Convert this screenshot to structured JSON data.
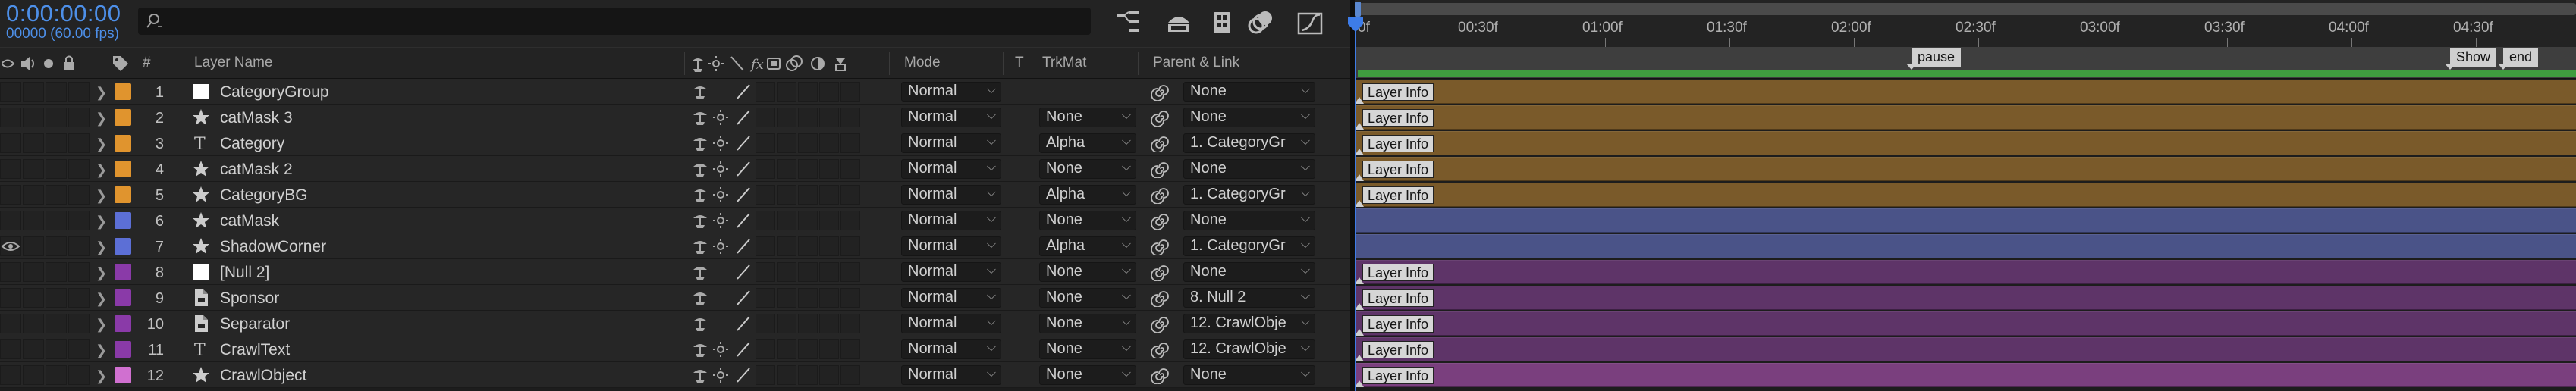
{
  "comp": {
    "timecode": "0:00:00:00",
    "fps": "00000 (60.00 fps)"
  },
  "columns": {
    "num": "#",
    "layer_name": "Layer Name",
    "mode": "Mode",
    "t": "T",
    "trkmat": "TrkMat",
    "parent": "Parent & Link"
  },
  "ruler": {
    "ticks": [
      "0f",
      "00:30f",
      "01:00f",
      "01:30f",
      "02:00f",
      "02:30f",
      "03:00f",
      "03:30f",
      "04:00f",
      "04:30f"
    ],
    "markers": [
      {
        "label": "pause"
      },
      {
        "label": "Show"
      },
      {
        "label": "end"
      }
    ]
  },
  "layers": [
    {
      "num": "1",
      "name": "CategoryGroup",
      "type": "solid-white",
      "label_color": "#e0942e",
      "mode": "Normal",
      "trkmat": "",
      "parent": "None",
      "bar_color": "#7a5a2a",
      "bar_marker": "Layer Info",
      "eye": false,
      "shy": false
    },
    {
      "num": "2",
      "name": "catMask 3",
      "type": "shape",
      "label_color": "#e0942e",
      "mode": "Normal",
      "trkmat": "None",
      "parent": "None",
      "bar_color": "#7a5a2a",
      "bar_marker": "Layer Info",
      "eye": false,
      "shy": true
    },
    {
      "num": "3",
      "name": "Category",
      "type": "text",
      "label_color": "#e0942e",
      "mode": "Normal",
      "trkmat": "Alpha",
      "parent": "1. CategoryGr",
      "bar_color": "#7a5a2a",
      "bar_marker": "Layer Info",
      "eye": false,
      "shy": true
    },
    {
      "num": "4",
      "name": "catMask 2",
      "type": "shape",
      "label_color": "#e0942e",
      "mode": "Normal",
      "trkmat": "None",
      "parent": "None",
      "bar_color": "#7a5a2a",
      "bar_marker": "Layer Info",
      "eye": false,
      "shy": true
    },
    {
      "num": "5",
      "name": "CategoryBG",
      "type": "shape",
      "label_color": "#e0942e",
      "mode": "Normal",
      "trkmat": "Alpha",
      "parent": "1. CategoryGr",
      "bar_color": "#7a5a2a",
      "bar_marker": "Layer Info",
      "eye": false,
      "shy": true
    },
    {
      "num": "6",
      "name": "catMask",
      "type": "shape",
      "label_color": "#5c6fd6",
      "mode": "Normal",
      "trkmat": "None",
      "parent": "None",
      "bar_color": "#4a5388",
      "bar_marker": "",
      "eye": false,
      "shy": true
    },
    {
      "num": "7",
      "name": "ShadowCorner",
      "type": "shape",
      "label_color": "#5c6fd6",
      "mode": "Normal",
      "trkmat": "Alpha",
      "parent": "1. CategoryGr",
      "bar_color": "#4a5388",
      "bar_marker": "",
      "eye": true,
      "shy": true
    },
    {
      "num": "8",
      "name": "[Null 2]",
      "type": "solid-white",
      "label_color": "#8a3aa8",
      "mode": "Normal",
      "trkmat": "None",
      "parent": "None",
      "bar_color": "#5e3468",
      "bar_marker": "Layer Info",
      "eye": false,
      "shy": false
    },
    {
      "num": "9",
      "name": "Sponsor",
      "type": "footage",
      "label_color": "#8a3aa8",
      "mode": "Normal",
      "trkmat": "None",
      "parent": "8. Null 2",
      "bar_color": "#5e3468",
      "bar_marker": "Layer Info",
      "eye": false,
      "shy": false
    },
    {
      "num": "10",
      "name": "Separator",
      "type": "footage",
      "label_color": "#8a3aa8",
      "mode": "Normal",
      "trkmat": "None",
      "parent": "12. CrawlObje",
      "bar_color": "#5e3468",
      "bar_marker": "Layer Info",
      "eye": false,
      "shy": false
    },
    {
      "num": "11",
      "name": "CrawlText",
      "type": "text",
      "label_color": "#8a3aa8",
      "mode": "Normal",
      "trkmat": "None",
      "parent": "12. CrawlObje",
      "bar_color": "#5e3468",
      "bar_marker": "Layer Info",
      "eye": false,
      "shy": true
    },
    {
      "num": "12",
      "name": "CrawlObject",
      "type": "shape",
      "label_color": "#d070d0",
      "mode": "Normal",
      "trkmat": "None",
      "parent": "None",
      "bar_color": "#7a3f7e",
      "bar_marker": "Layer Info",
      "eye": false,
      "shy": true
    }
  ]
}
